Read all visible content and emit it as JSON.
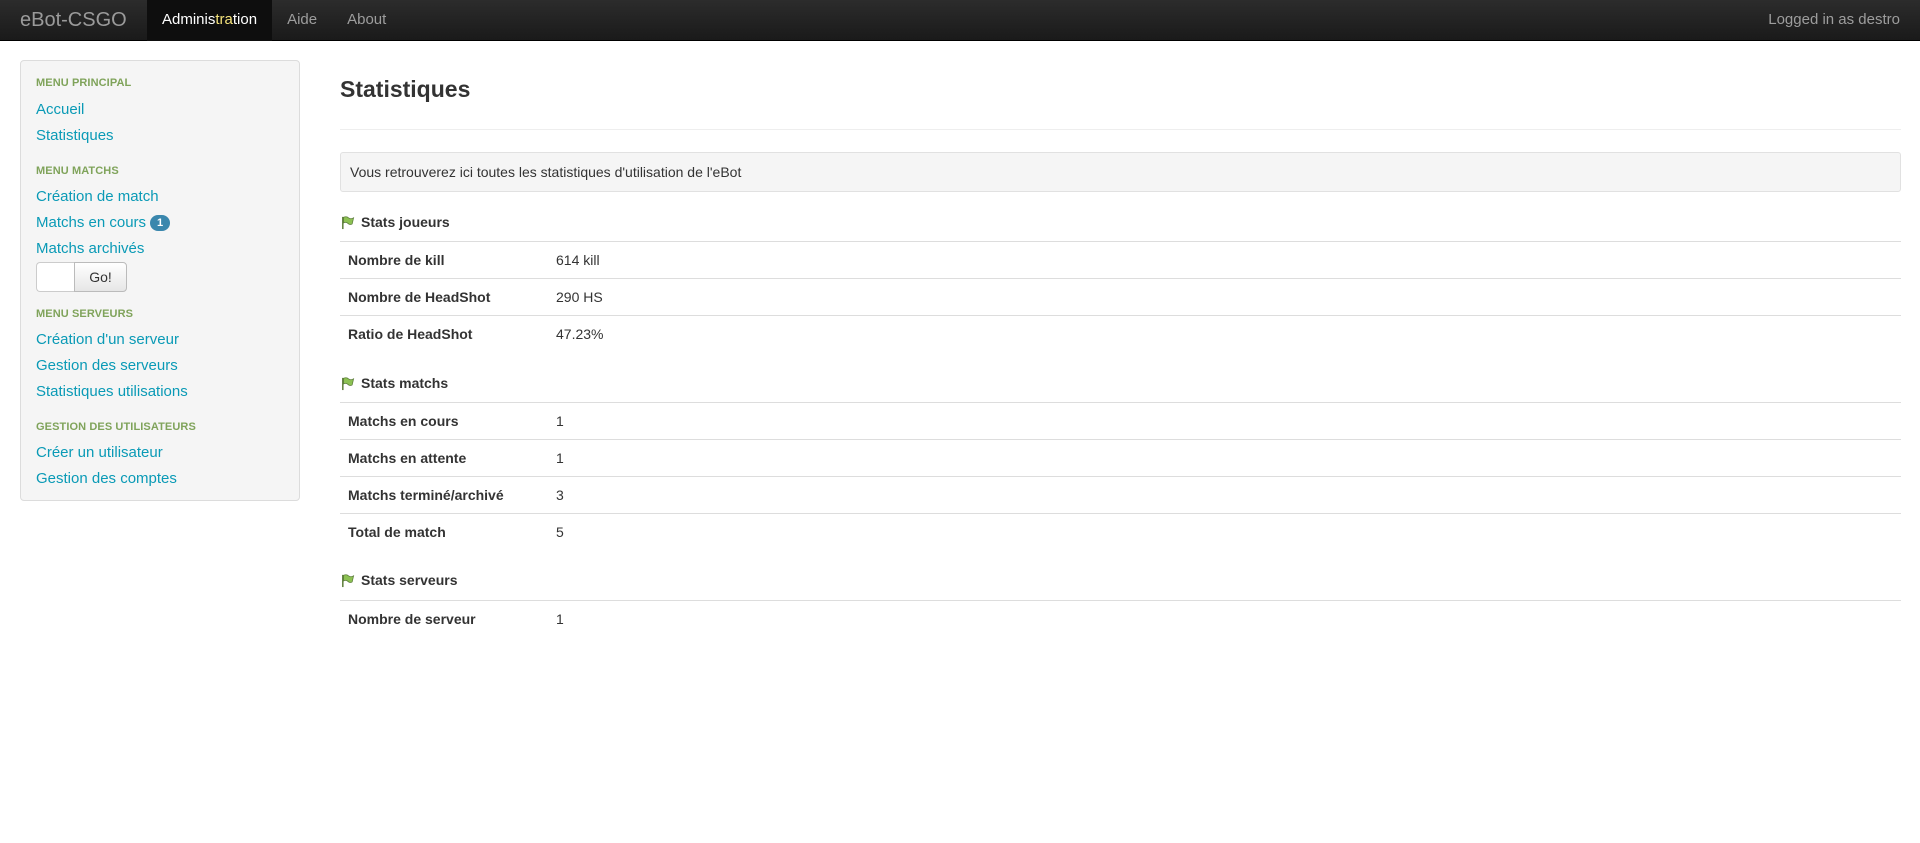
{
  "navbar": {
    "brand": "eBot-CSGO",
    "items": [
      {
        "label_pre": "Adminis",
        "label_hl": "tra",
        "label_post": "tion"
      },
      {
        "label": "Aide"
      },
      {
        "label": "About"
      }
    ],
    "user_text": "Logged in as destro"
  },
  "sidebar": {
    "menu_principal": {
      "header": "MENU PRINCIPAL",
      "items": [
        "Accueil",
        "Statistiques"
      ]
    },
    "menu_matchs": {
      "header": "MENU MATCHS",
      "items": [
        "Création de match",
        "Matchs en cours",
        "Matchs archivés"
      ],
      "badge": "1",
      "go_label": "Go!",
      "search_value": ""
    },
    "menu_serveurs": {
      "header": "MENU SERVEURS",
      "items": [
        "Création d'un serveur",
        "Gestion des serveurs",
        "Statistiques utilisations"
      ]
    },
    "menu_utilisateurs": {
      "header": "GESTION DES UTILISATEURS",
      "items": [
        "Créer un utilisateur",
        "Gestion des comptes"
      ]
    }
  },
  "main": {
    "title": "Statistiques",
    "info": "Vous retrouverez ici toutes les statistiques d'utilisation de l'eBot",
    "sections": [
      {
        "title": "Stats joueurs",
        "rows": [
          {
            "label": "Nombre de kill",
            "value": "614 kill"
          },
          {
            "label": "Nombre de HeadShot",
            "value": "290 HS"
          },
          {
            "label": "Ratio de HeadShot",
            "value": "47.23%"
          }
        ]
      },
      {
        "title": "Stats matchs",
        "rows": [
          {
            "label": "Matchs en cours",
            "value": "1"
          },
          {
            "label": "Matchs en attente",
            "value": "1"
          },
          {
            "label": "Matchs terminé/archivé",
            "value": "3"
          },
          {
            "label": "Total de match",
            "value": "5"
          }
        ]
      },
      {
        "title": "Stats serveurs",
        "rows": [
          {
            "label": "Nombre de serveur",
            "value": "1"
          }
        ]
      }
    ]
  },
  "colors": {
    "link": "#0a9ab6",
    "sidebar_header": "#7fa35a",
    "badge": "#3a87ad",
    "navbar": "#1b1b1b"
  }
}
